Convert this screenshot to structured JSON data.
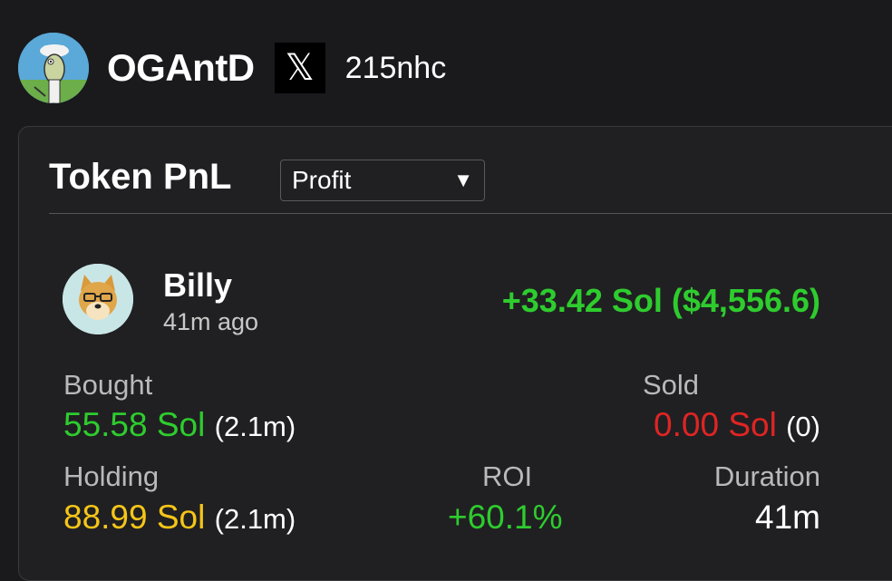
{
  "profile": {
    "username": "OGAntD",
    "x_icon": "𝕏",
    "handle": "215nhc"
  },
  "card": {
    "title": "Token PnL",
    "filter": {
      "selected": "Profit",
      "arrow": "▼"
    }
  },
  "token": {
    "name": "Billy",
    "time_ago": "41m ago",
    "pnl": "+33.42 Sol ($4,556.6)"
  },
  "stats": {
    "bought": {
      "label": "Bought",
      "value": "55.58 Sol",
      "sub": "(2.1m)"
    },
    "sold": {
      "label": "Sold",
      "value": "0.00 Sol",
      "sub": "(0)"
    },
    "holding": {
      "label": "Holding",
      "value": "88.99 Sol",
      "sub": "(2.1m)"
    },
    "roi": {
      "label": "ROI",
      "value": "+60.1%"
    },
    "duration": {
      "label": "Duration",
      "value": "41m"
    }
  },
  "colors": {
    "positive": "#2ecc2e",
    "negative": "#e02424",
    "holding": "#f5c518"
  }
}
